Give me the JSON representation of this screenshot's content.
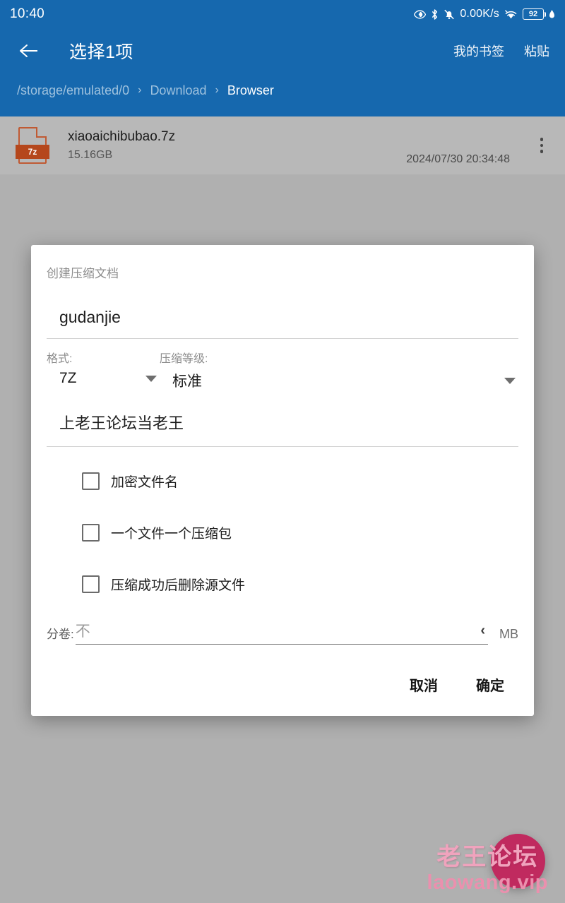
{
  "colors": {
    "appbar_blue": "#1668AE",
    "scrim_gray": "#B0B0B0",
    "row_gray": "#B8B8B8",
    "fab_magenta": "#C02A5F",
    "archive_orange": "#B5471C",
    "watermark_pink": "#EB90AE"
  },
  "statusbar": {
    "clock": "10:40",
    "net_speed": "0.00K/s",
    "battery_level": "92",
    "icons": [
      "eye-icon",
      "bluetooth-icon",
      "bell-muted-icon",
      "wifi-icon",
      "battery-icon",
      "charging-drop-icon"
    ]
  },
  "appbar": {
    "back_icon": "back-arrow-icon",
    "title": "选择1项",
    "actions": [
      {
        "label": "我的书签"
      },
      {
        "label": "粘贴"
      }
    ],
    "breadcrumb": {
      "parts": [
        "/storage/emulated/0",
        "Download",
        "Browser"
      ],
      "separator": "›"
    }
  },
  "file_list": {
    "rows": [
      {
        "icon_badge": "7z",
        "name": "xiaoaichibubao.7z",
        "size": "15.16GB",
        "date": "2024/07/30 20:34:48",
        "overflow": "more-vert-icon"
      }
    ]
  },
  "dialog": {
    "title": "创建压缩文档",
    "archive_name": {
      "value": "gudanjie"
    },
    "format": {
      "label": "格式:",
      "value": "7Z"
    },
    "level": {
      "label": "压缩等级:",
      "value": "标准"
    },
    "password": {
      "value": "上老王论坛当老王"
    },
    "checkboxes": [
      {
        "label": "加密文件名",
        "checked": false
      },
      {
        "label": "一个文件一个压缩包",
        "checked": false
      },
      {
        "label": "压缩成功后删除源文件",
        "checked": false
      }
    ],
    "split": {
      "label": "分卷:",
      "placeholder": "不",
      "stepper_icon": "chevron-left-icon",
      "unit": "MB"
    },
    "buttons": {
      "cancel": "取消",
      "confirm": "确定"
    }
  },
  "fab": {
    "name": "add-fab"
  },
  "watermark": {
    "line1": "老王论坛",
    "line2": "laowang.vip"
  }
}
